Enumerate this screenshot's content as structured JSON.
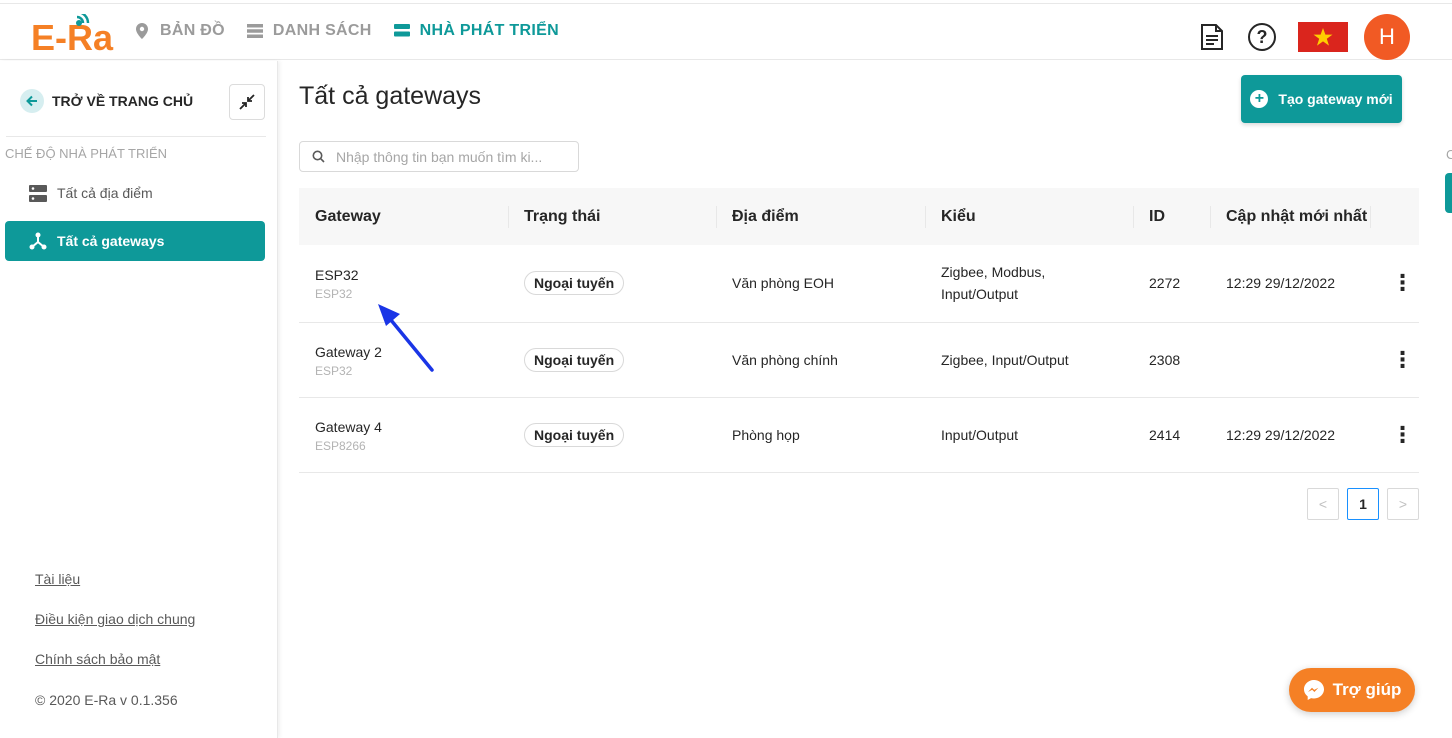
{
  "brand": {
    "logo_text": "E-Ra",
    "accent": "#0e9999",
    "logo_color": "#f58025"
  },
  "nav": [
    {
      "label": "BẢN ĐỒ",
      "icon": "map-pin-icon"
    },
    {
      "label": "DANH SÁCH",
      "icon": "list-icon"
    },
    {
      "label": "NHÀ PHÁT TRIỂN",
      "icon": "developer-icon",
      "active": true
    }
  ],
  "header": {
    "avatar_letter": "H",
    "icons": [
      "document-icon",
      "help-circle-icon",
      "vietnam-flag-icon"
    ]
  },
  "sidebar": {
    "back_label": "TRỞ VỀ TRANG CHỦ",
    "section_title": "CHẾ ĐỘ NHÀ PHÁT TRIỂN",
    "items": [
      {
        "label": "Tất cả địa điểm",
        "icon": "server-icon"
      },
      {
        "label": "Tất cả gateways",
        "icon": "gateway-icon",
        "active": true
      }
    ],
    "links": [
      "Tài liệu",
      "Điều kiện giao dịch chung",
      "Chính sách bảo mật"
    ],
    "copyright": "© 2020 E-Ra v 0.1.356"
  },
  "main": {
    "title": "Tất cả gateways",
    "create_button": "Tạo gateway mới",
    "search_placeholder": "Nhập thông tin bạn muốn tìm ki...",
    "columns": [
      "Gateway",
      "Trạng thái",
      "Địa điểm",
      "Kiểu",
      "ID",
      "Cập nhật mới nhất"
    ],
    "rows": [
      {
        "name": "ESP32",
        "board": "ESP32",
        "status": "Ngoại tuyến",
        "location": "Văn phòng EOH",
        "type_line1": "Zigbee, Modbus,",
        "type_line2": "Input/Output",
        "id": "2272",
        "updated": "12:29 29/12/2022"
      },
      {
        "name": "Gateway 2",
        "board": "ESP32",
        "status": "Ngoại tuyến",
        "location": "Văn phòng chính",
        "type_line1": "Zigbee, Input/Output",
        "type_line2": "",
        "id": "2308",
        "updated": ""
      },
      {
        "name": "Gateway 4",
        "board": "ESP8266",
        "status": "Ngoại tuyến",
        "location": "Phòng họp",
        "type_line1": "Input/Output",
        "type_line2": "",
        "id": "2414",
        "updated": "12:29 29/12/2022"
      }
    ],
    "pagination": {
      "prev": "<",
      "current": "1",
      "next": ">"
    }
  },
  "help_button": "Trợ giúp",
  "edge_label": "C"
}
